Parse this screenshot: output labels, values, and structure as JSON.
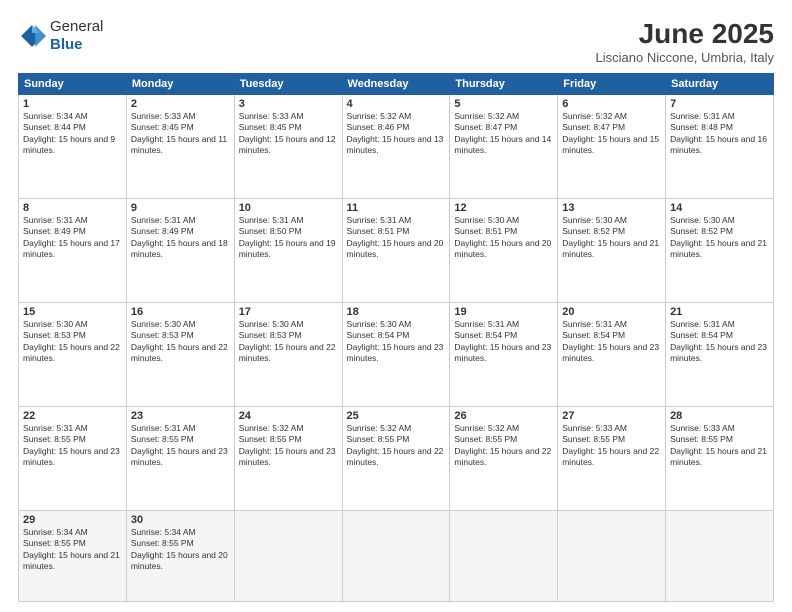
{
  "logo": {
    "general": "General",
    "blue": "Blue"
  },
  "title": "June 2025",
  "location": "Lisciano Niccone, Umbria, Italy",
  "days_of_week": [
    "Sunday",
    "Monday",
    "Tuesday",
    "Wednesday",
    "Thursday",
    "Friday",
    "Saturday"
  ],
  "weeks": [
    [
      {
        "day": "1",
        "sunrise": "5:34 AM",
        "sunset": "8:44 PM",
        "daylight": "15 hours and 9 minutes."
      },
      {
        "day": "2",
        "sunrise": "5:33 AM",
        "sunset": "8:45 PM",
        "daylight": "15 hours and 11 minutes."
      },
      {
        "day": "3",
        "sunrise": "5:33 AM",
        "sunset": "8:45 PM",
        "daylight": "15 hours and 12 minutes."
      },
      {
        "day": "4",
        "sunrise": "5:32 AM",
        "sunset": "8:46 PM",
        "daylight": "15 hours and 13 minutes."
      },
      {
        "day": "5",
        "sunrise": "5:32 AM",
        "sunset": "8:47 PM",
        "daylight": "15 hours and 14 minutes."
      },
      {
        "day": "6",
        "sunrise": "5:32 AM",
        "sunset": "8:47 PM",
        "daylight": "15 hours and 15 minutes."
      },
      {
        "day": "7",
        "sunrise": "5:31 AM",
        "sunset": "8:48 PM",
        "daylight": "15 hours and 16 minutes."
      }
    ],
    [
      {
        "day": "8",
        "sunrise": "5:31 AM",
        "sunset": "8:49 PM",
        "daylight": "15 hours and 17 minutes."
      },
      {
        "day": "9",
        "sunrise": "5:31 AM",
        "sunset": "8:49 PM",
        "daylight": "15 hours and 18 minutes."
      },
      {
        "day": "10",
        "sunrise": "5:31 AM",
        "sunset": "8:50 PM",
        "daylight": "15 hours and 19 minutes."
      },
      {
        "day": "11",
        "sunrise": "5:31 AM",
        "sunset": "8:51 PM",
        "daylight": "15 hours and 20 minutes."
      },
      {
        "day": "12",
        "sunrise": "5:30 AM",
        "sunset": "8:51 PM",
        "daylight": "15 hours and 20 minutes."
      },
      {
        "day": "13",
        "sunrise": "5:30 AM",
        "sunset": "8:52 PM",
        "daylight": "15 hours and 21 minutes."
      },
      {
        "day": "14",
        "sunrise": "5:30 AM",
        "sunset": "8:52 PM",
        "daylight": "15 hours and 21 minutes."
      }
    ],
    [
      {
        "day": "15",
        "sunrise": "5:30 AM",
        "sunset": "8:53 PM",
        "daylight": "15 hours and 22 minutes."
      },
      {
        "day": "16",
        "sunrise": "5:30 AM",
        "sunset": "8:53 PM",
        "daylight": "15 hours and 22 minutes."
      },
      {
        "day": "17",
        "sunrise": "5:30 AM",
        "sunset": "8:53 PM",
        "daylight": "15 hours and 22 minutes."
      },
      {
        "day": "18",
        "sunrise": "5:30 AM",
        "sunset": "8:54 PM",
        "daylight": "15 hours and 23 minutes."
      },
      {
        "day": "19",
        "sunrise": "5:31 AM",
        "sunset": "8:54 PM",
        "daylight": "15 hours and 23 minutes."
      },
      {
        "day": "20",
        "sunrise": "5:31 AM",
        "sunset": "8:54 PM",
        "daylight": "15 hours and 23 minutes."
      },
      {
        "day": "21",
        "sunrise": "5:31 AM",
        "sunset": "8:54 PM",
        "daylight": "15 hours and 23 minutes."
      }
    ],
    [
      {
        "day": "22",
        "sunrise": "5:31 AM",
        "sunset": "8:55 PM",
        "daylight": "15 hours and 23 minutes."
      },
      {
        "day": "23",
        "sunrise": "5:31 AM",
        "sunset": "8:55 PM",
        "daylight": "15 hours and 23 minutes."
      },
      {
        "day": "24",
        "sunrise": "5:32 AM",
        "sunset": "8:55 PM",
        "daylight": "15 hours and 23 minutes."
      },
      {
        "day": "25",
        "sunrise": "5:32 AM",
        "sunset": "8:55 PM",
        "daylight": "15 hours and 22 minutes."
      },
      {
        "day": "26",
        "sunrise": "5:32 AM",
        "sunset": "8:55 PM",
        "daylight": "15 hours and 22 minutes."
      },
      {
        "day": "27",
        "sunrise": "5:33 AM",
        "sunset": "8:55 PM",
        "daylight": "15 hours and 22 minutes."
      },
      {
        "day": "28",
        "sunrise": "5:33 AM",
        "sunset": "8:55 PM",
        "daylight": "15 hours and 21 minutes."
      }
    ],
    [
      {
        "day": "29",
        "sunrise": "5:34 AM",
        "sunset": "8:55 PM",
        "daylight": "15 hours and 21 minutes."
      },
      {
        "day": "30",
        "sunrise": "5:34 AM",
        "sunset": "8:55 PM",
        "daylight": "15 hours and 20 minutes."
      },
      null,
      null,
      null,
      null,
      null
    ]
  ],
  "labels": {
    "sunrise": "Sunrise:",
    "sunset": "Sunset:",
    "daylight": "Daylight:"
  }
}
